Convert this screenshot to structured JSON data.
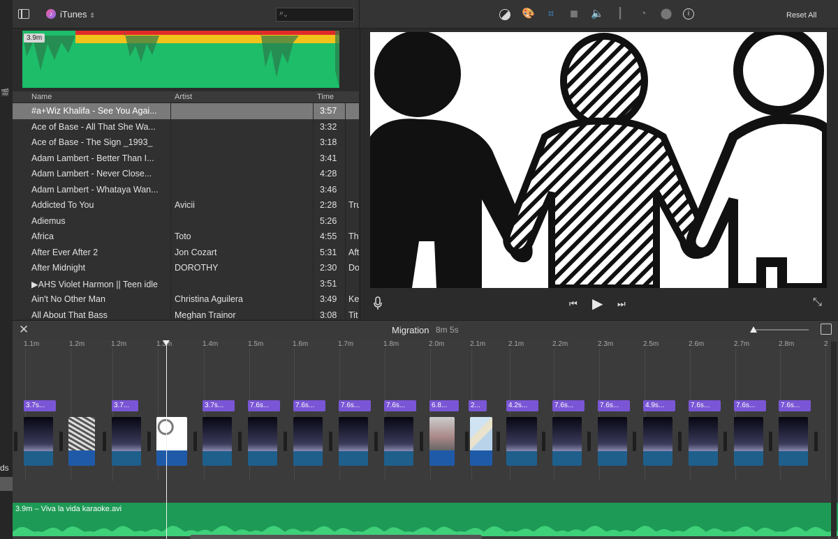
{
  "left_strip": {
    "edge_text": "ds"
  },
  "topbar": {
    "library": "iTunes",
    "search_placeholder": "",
    "reset_all": "Reset All"
  },
  "audio_overview": {
    "label": "3.9m"
  },
  "table": {
    "columns": [
      "Name",
      "Artist",
      "Time"
    ],
    "rows": [
      {
        "name": "#a+Wiz Khalifa - See You Agai...",
        "artist": "",
        "time": "3:57",
        "extra": ""
      },
      {
        "name": "Ace of Base - All That She Wa...",
        "artist": "",
        "time": "3:32",
        "extra": ""
      },
      {
        "name": "Ace of Base - The Sign _1993_",
        "artist": "",
        "time": "3:18",
        "extra": ""
      },
      {
        "name": "Adam Lambert - Better Than I...",
        "artist": "",
        "time": "3:41",
        "extra": ""
      },
      {
        "name": "Adam Lambert - Never Close...",
        "artist": "",
        "time": "4:28",
        "extra": ""
      },
      {
        "name": "Adam Lambert - Whataya Wan...",
        "artist": "",
        "time": "3:46",
        "extra": ""
      },
      {
        "name": "Addicted To You",
        "artist": "Avicii",
        "time": "2:28",
        "extra": "Tru"
      },
      {
        "name": "Adiemus",
        "artist": "",
        "time": "5:26",
        "extra": ""
      },
      {
        "name": "Africa",
        "artist": "Toto",
        "time": "4:55",
        "extra": "Th"
      },
      {
        "name": "After Ever After 2",
        "artist": "Jon Cozart",
        "time": "5:31",
        "extra": "Aft"
      },
      {
        "name": "After Midnight",
        "artist": "DOROTHY",
        "time": "2:30",
        "extra": "Do"
      },
      {
        "name": "▶AHS Violet Harmon || Teen idle",
        "artist": "",
        "time": "3:51",
        "extra": ""
      },
      {
        "name": "Ain't No Other Man",
        "artist": "Christina Aguilera",
        "time": "3:49",
        "extra": "Ke"
      },
      {
        "name": "All About That Bass",
        "artist": "Meghan Trainor",
        "time": "3:08",
        "extra": "Tit"
      }
    ]
  },
  "timeline": {
    "title": "Migration",
    "duration": "8m 5s",
    "ruler": [
      "1.1m",
      "1.2m",
      "1.2m",
      "1.3m",
      "1.4m",
      "1.5m",
      "1.6m",
      "1.7m",
      "1.8m",
      "2.0m",
      "2.1m",
      "2.1m",
      "2.2m",
      "2.3m",
      "2.5m",
      "2.6m",
      "2.7m",
      "2.8m",
      "2"
    ],
    "title_tags": [
      "3.7s...",
      "3.7...",
      "3.7s...",
      "7.6s...",
      "7.6s...",
      "7.6s...",
      "7.6s...",
      "6.8...",
      "2...",
      "4.2s...",
      "7.6s...",
      "7.6s...",
      "4.9s...",
      "7.6s...",
      "7.6s...",
      "7.6s..."
    ],
    "music_label": "3.9m – Viva la vida karaoke.avi"
  },
  "colors": {
    "accent_blue": "#3f9ae8",
    "title_purple": "#7a56d6",
    "audio_green": "#1d9a55"
  }
}
